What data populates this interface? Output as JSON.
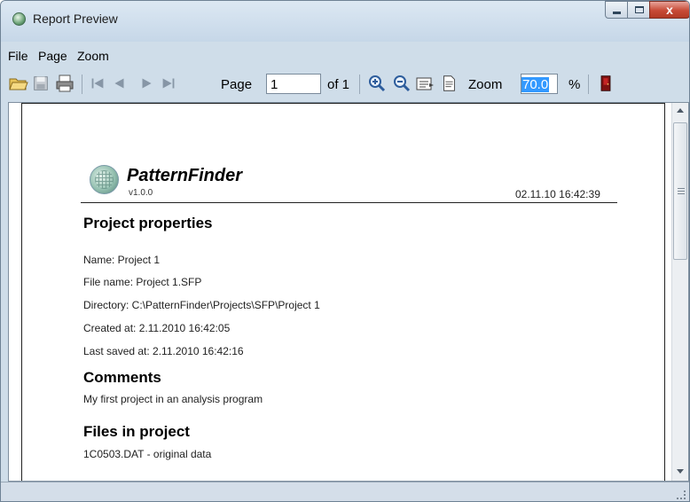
{
  "window": {
    "title": "Report Preview",
    "controls": {
      "close_label": "x"
    }
  },
  "menubar": {
    "items": [
      "File",
      "Page",
      "Zoom"
    ]
  },
  "toolbar": {
    "page_label": "Page",
    "page_value": "1",
    "of_label": "of 1",
    "zoom_label": "Zoom",
    "zoom_value": "70.0",
    "percent_label": "%"
  },
  "report": {
    "app_name": "PatternFinder",
    "version": "v1.0.0",
    "timestamp": "02.11.10 16:42:39",
    "project_properties_heading": "Project properties",
    "properties": [
      "Name: Project 1",
      "File name: Project 1.SFP",
      "Directory: C:\\PatternFinder\\Projects\\SFP\\Project 1",
      "Created at: 2.11.2010 16:42:05",
      "Last saved at: 2.11.2010 16:42:16"
    ],
    "comments_heading": "Comments",
    "comments_text": "My first project in an analysis program",
    "files_heading": "Files in project",
    "files": [
      "1C0503.DAT - original data"
    ]
  },
  "colors": {
    "titlebar": "#dce8f3",
    "close_button": "#c74a36",
    "selection": "#3399ff"
  }
}
